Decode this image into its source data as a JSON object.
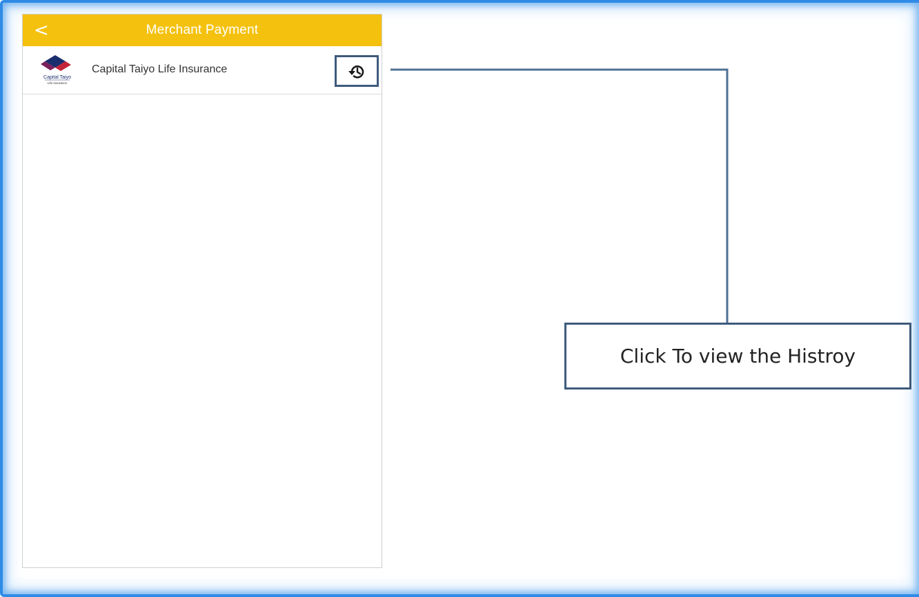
{
  "header": {
    "back_label": "<",
    "title": "Merchant Payment"
  },
  "merchant": {
    "name": "Capital Taiyo Life Insurance",
    "logo_text_line1": "Capital Taiyo",
    "logo_text_line2": "Life Insurance",
    "history_icon": "history-icon"
  },
  "callout": {
    "text": "Click To view the Histroy"
  },
  "colors": {
    "header_bg": "#f4c10e",
    "frame_blue": "#2f8be6",
    "callout_border": "#3d5a7b",
    "connector": "#4f6f95"
  }
}
